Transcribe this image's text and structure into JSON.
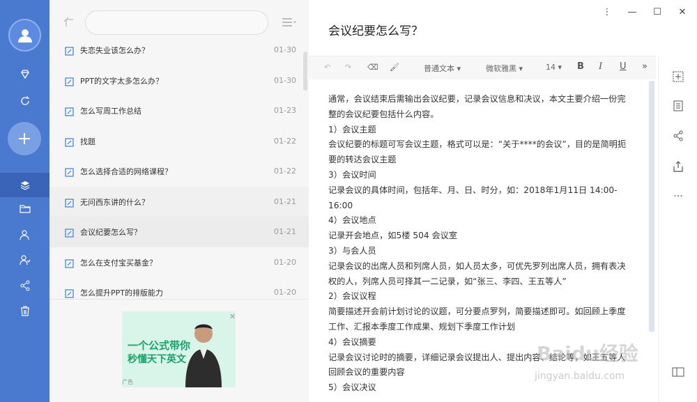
{
  "notes": [
    {
      "title": "失恋失业该怎么办？",
      "date": "01-30"
    },
    {
      "title": "PPT的文字太多怎么办？",
      "date": "01-30"
    },
    {
      "title": "怎么写周工作总结",
      "date": "01-23"
    },
    {
      "title": "找题",
      "date": "01-22"
    },
    {
      "title": "怎么选择合适的网络课程？",
      "date": "01-22"
    },
    {
      "title": "无问西东讲的什么？",
      "date": "01-21"
    },
    {
      "title": "会议纪要怎么写？",
      "date": "01-21"
    },
    {
      "title": "怎么在支付宝买基金？",
      "date": "01-20"
    },
    {
      "title": "怎么提升PPT的排版能力",
      "date": "01-20"
    }
  ],
  "ad": {
    "line1": "一个公式带你",
    "line2": "秒懂天下英文",
    "label": "广告"
  },
  "editor": {
    "title": "会议纪要怎么写？",
    "toolbar": {
      "style": "普通文本",
      "font": "微软雅黑",
      "size": "14",
      "bold": "B",
      "italic": "I",
      "underline": "U",
      "more": "»"
    },
    "paragraphs": [
      "通常，会议结束后需输出会议纪要，记录会议信息和决议，本文主要介绍一份完整的会议纪要包括什么内容。",
      "1）会议主题",
      "会议纪要的标题可写会议主题，格式可以是：“关于****的会议”，目的是简明扼要的转达会议主题",
      "3）会议时间",
      "记录会议的具体时间，包括年、月、日、时分，如：2018年1月11日 14:00-16:00",
      "4）会议地点",
      "记录开会地点，如5楼 504 会议室",
      "3）与会人员",
      "记录会议的出席人员和列席人员，如人员太多，可优先罗列出席人员，拥有表决权的人，列席人员可择其一二记录，如“张三、李四、王五等人”",
      "2）会议议程",
      "简要描述开会前计划讨论的议题，可分要点罗列，简要描述即可。如回顾上季度工作、汇报本季度工作成果、规划下季度工作计划",
      "4）会议摘要",
      "记录会议讨论时的摘要，详细记录会议提出人、提出内容、结论等，如王五等人回顾会议的重要内容",
      "5）会议决议"
    ]
  },
  "watermark": {
    "main": "Baidu经验",
    "sub": "jingyan.baidu.com"
  },
  "colors": {
    "rail": "#4a79d0",
    "rail_active": "#3a64b8",
    "accent": "#4a79d0"
  }
}
